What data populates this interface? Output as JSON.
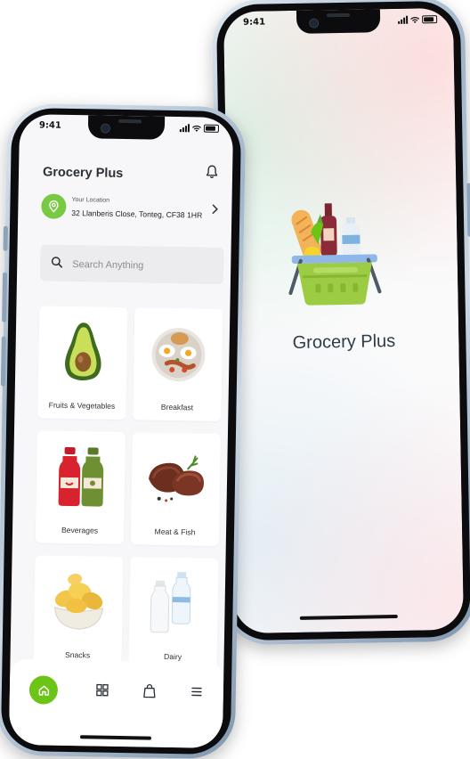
{
  "back_screen": {
    "status_time": "9:41",
    "app_name": "Grocery Plus"
  },
  "front_screen": {
    "status_time": "9:41",
    "app_title": "Grocery Plus",
    "location": {
      "label": "Your Location",
      "address": "32 Llanberis Close, Tonteg, CF38 1HR"
    },
    "search": {
      "placeholder": "Search Anything"
    },
    "categories": [
      {
        "label": "Fruits & Vegetables",
        "icon": "avocado-icon"
      },
      {
        "label": "Breakfast",
        "icon": "breakfast-plate-icon"
      },
      {
        "label": "Beverages",
        "icon": "juice-bottles-icon"
      },
      {
        "label": "Meat & Fish",
        "icon": "steak-icon"
      },
      {
        "label": "Snacks",
        "icon": "chips-bowl-icon"
      },
      {
        "label": "Dairy",
        "icon": "milk-bottles-icon"
      }
    ],
    "bottom_nav": [
      {
        "name": "home",
        "icon": "home-icon",
        "active": true
      },
      {
        "name": "categories",
        "icon": "grid-icon",
        "active": false
      },
      {
        "name": "cart",
        "icon": "bag-icon",
        "active": false
      },
      {
        "name": "menu",
        "icon": "menu-icon",
        "active": false
      }
    ]
  },
  "colors": {
    "accent_green": "#6cc417",
    "title_text": "#2e3a46",
    "search_bg": "#ececef"
  }
}
